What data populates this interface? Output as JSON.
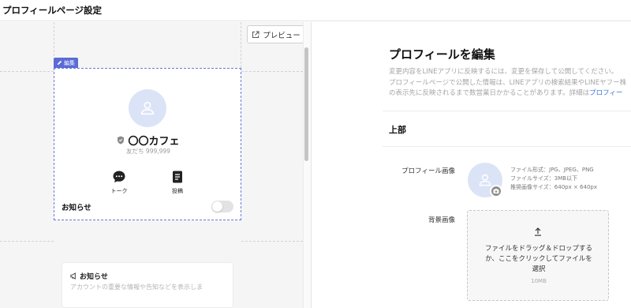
{
  "header": {
    "title": "プロフィールページ設定"
  },
  "preview": {
    "button_label": "プレビュー",
    "edit_badge": "編集",
    "profile": {
      "name": "〇〇カフェ",
      "friends": "友だち 999,999"
    },
    "actions": [
      {
        "label": "トーク",
        "icon": "chat-bubble-icon"
      },
      {
        "label": "投稿",
        "icon": "post-document-icon"
      }
    ],
    "notice": {
      "section_title": "お知らせ",
      "toggle_on": false,
      "card_title": "お知らせ",
      "card_desc": "アカウントの重要な情報や告知などを表示しま"
    }
  },
  "editor": {
    "title": "プロフィールを編集",
    "desc_line1": "変更内容をLINEアプリに反映するには、変更を保存して公開してください。",
    "desc_line2": "プロフィールページで公開した情報は、LINEアプリの検索結果やLINEヤフー株",
    "desc_line3": "の表示先に反映されるまで数営業日かかることがあります。詳細は",
    "desc_link": "プロフィー",
    "section_title": "上部",
    "profile_image": {
      "label": "プロフィール画像",
      "spec_format": "ファイル形式：JPG、JPEG、PNG",
      "spec_size": "ファイルサイズ：3MB以下",
      "spec_recommend": "推奨画像サイズ：640px × 640px"
    },
    "background": {
      "label": "背景画像",
      "drop_line1": "ファイルをドラッグ＆ドロップする",
      "drop_line2": "か、ここをクリックしてファイルを",
      "drop_line3": "選択",
      "limit": "10MB"
    }
  },
  "colors": {
    "accent": "#5b6bd7",
    "avatar_bg": "#dbe3f7",
    "link": "#3b73d9"
  }
}
